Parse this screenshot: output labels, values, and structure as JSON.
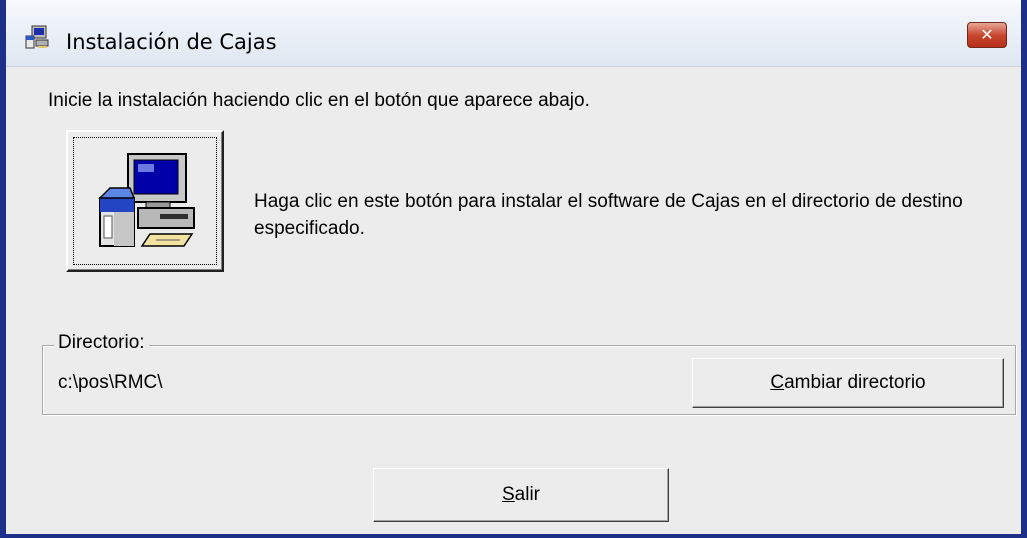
{
  "window": {
    "title": "Instalación de Cajas",
    "close_label": "✕"
  },
  "main": {
    "intro": "Inicie la instalación haciendo clic en el botón que aparece abajo.",
    "install_description": "Haga clic en este botón para instalar el software de Cajas en el directorio de destino especificado.",
    "install_icon": "computer-setup-icon"
  },
  "directory": {
    "label": "Directorio:",
    "value": "c:\\pos\\RMC\\",
    "change_button": {
      "mnemonic": "C",
      "rest": "ambiar directorio"
    }
  },
  "footer": {
    "exit_button": {
      "mnemonic": "S",
      "rest": "alir"
    }
  },
  "colors": {
    "window_frame": "#1e2f8a",
    "dialog_bg": "#ececec",
    "close_button": "#c7452e",
    "monitor_screen": "#0000a8"
  }
}
